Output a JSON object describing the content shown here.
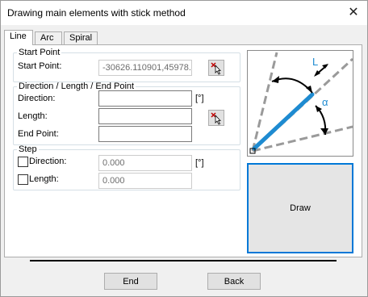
{
  "window": {
    "title": "Drawing main elements with stick method"
  },
  "tabs": [
    {
      "label": "Line",
      "active": true
    },
    {
      "label": "Arc",
      "active": false
    },
    {
      "label": "Spiral",
      "active": false
    }
  ],
  "start_point": {
    "group_label": "Start Point",
    "field_label": "Start Point:",
    "value": "-30626.110901,45978.8"
  },
  "direction_group": {
    "group_label": "Direction / Length / End Point",
    "direction_label": "Direction:",
    "direction_value": "",
    "direction_unit": "[°]",
    "length_label": "Length:",
    "length_value": "",
    "end_point_label": "End Point:",
    "end_point_value": ""
  },
  "step": {
    "group_label": "Step",
    "direction_label": "Direction:",
    "direction_checked": false,
    "direction_value": "0.000",
    "direction_unit": "[°]",
    "length_label": "Length:",
    "length_checked": false,
    "length_value": "0.000"
  },
  "diagram": {
    "length_symbol": "L",
    "angle_symbol": "α",
    "accent_color": "#1e8bd1"
  },
  "buttons": {
    "draw": "Draw",
    "end": "End",
    "back": "Back"
  }
}
